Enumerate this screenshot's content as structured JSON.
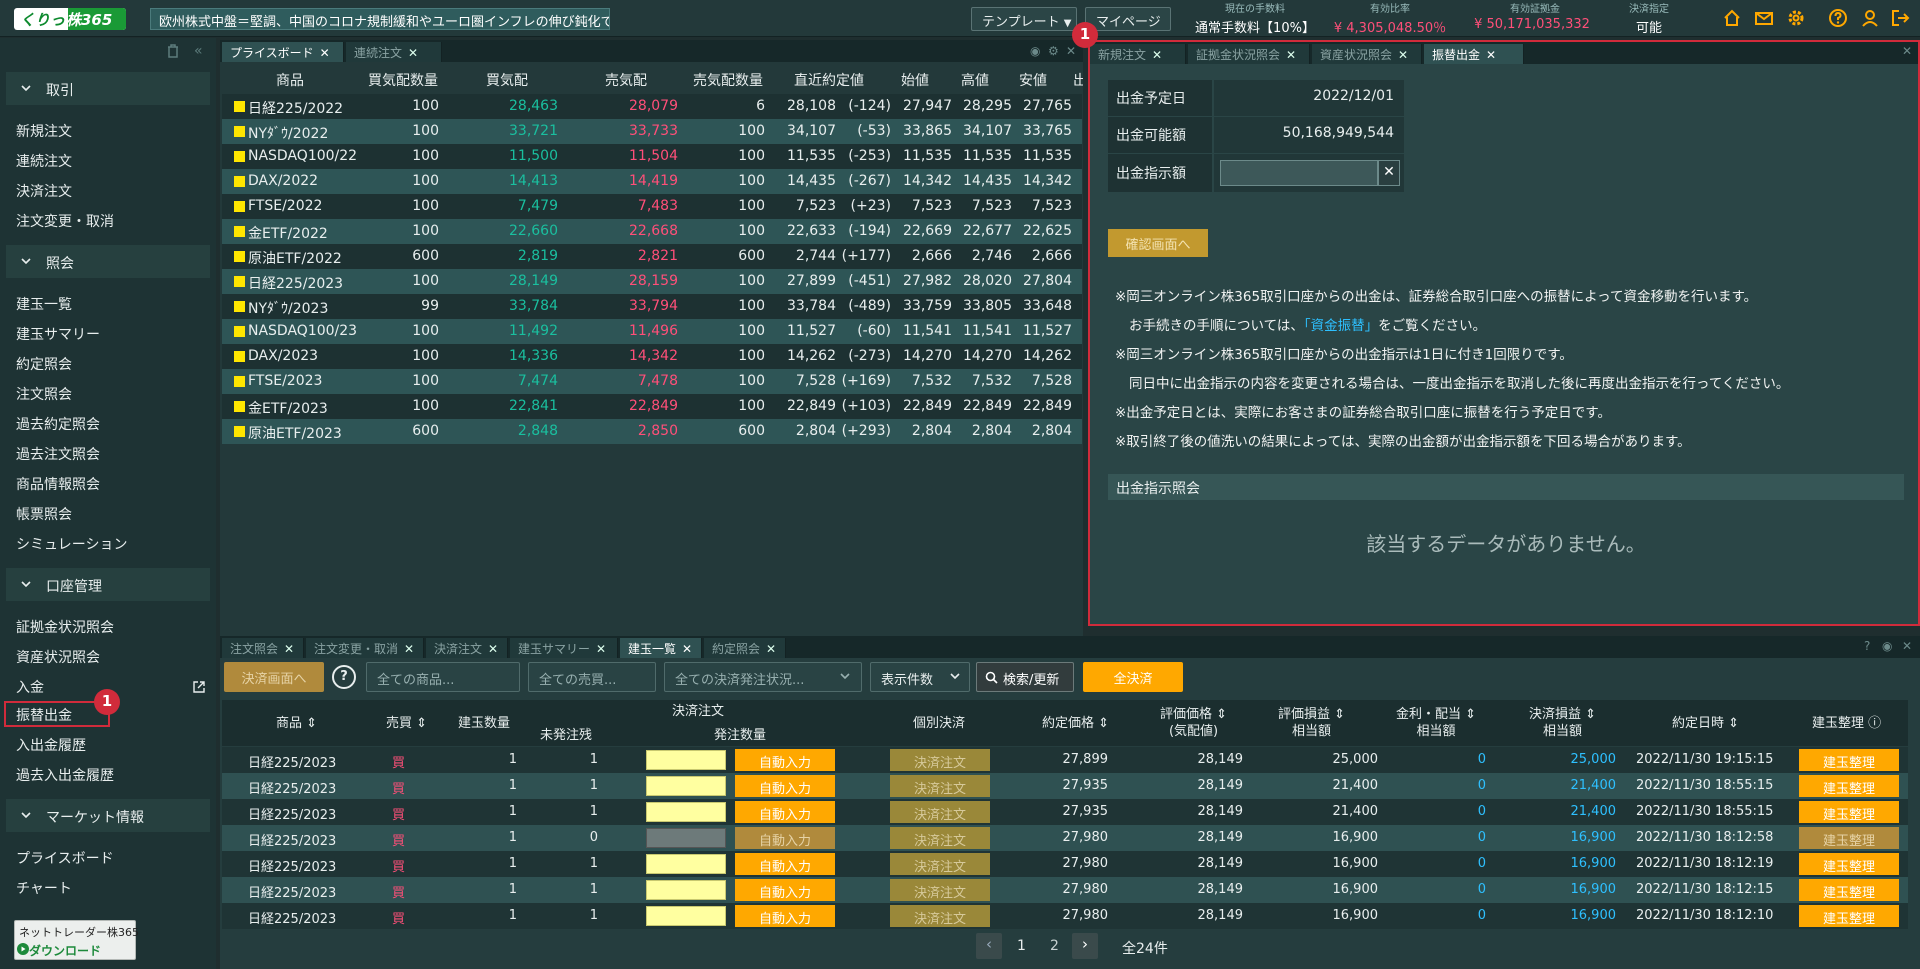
{
  "header": {
    "logo": {
      "part1": "くりっく",
      "part2": "株365"
    },
    "ticker": "欧州株式中盤＝堅調、中国のコロナ規制緩和やユーロ圏インフレの伸び鈍化で",
    "template_label": "テンプレート",
    "mypage_label": "マイページ",
    "fee": {
      "label": "現在の手数料",
      "value": "通常手数料【10%】"
    },
    "margin_ratio": {
      "label": "有効比率",
      "value": "¥ 4,305,048.50％"
    },
    "effective_margin": {
      "label": "有効証拠金",
      "value": "¥ 50,171,035,332"
    },
    "settlement": {
      "label": "決済指定",
      "value": "可能"
    }
  },
  "sidebar": {
    "sections": [
      {
        "label": "取引",
        "items": [
          "新規注文",
          "連続注文",
          "決済注文",
          "注文変更・取消"
        ]
      },
      {
        "label": "照会",
        "items": [
          "建玉一覧",
          "建玉サマリー",
          "約定照会",
          "注文照会",
          "過去約定照会",
          "過去注文照会",
          "商品情報照会",
          "帳票照会",
          "シミュレーション"
        ]
      },
      {
        "label": "口座管理",
        "items": [
          "証拠金状況照会",
          "資産状況照会",
          "入金",
          "振替出金",
          "入出金履歴",
          "過去入出金履歴"
        ]
      },
      {
        "label": "マーケット情報",
        "items": [
          "プライスボード",
          "チャート"
        ]
      }
    ],
    "download": {
      "line1": "ネットトレーダー株365",
      "line2": "ダウンロード"
    }
  },
  "priceboard": {
    "tabs": [
      "プライスボード",
      "連続注文"
    ],
    "columns": [
      "商品",
      "買気配数量",
      "買気配",
      "売気配",
      "売気配数量",
      "直近約定値",
      "始値",
      "高値",
      "安値",
      "出"
    ],
    "rows": [
      [
        "日経225/2022",
        "100",
        "28,463",
        "28,079",
        "6",
        "28,108",
        "(-124)",
        "27,947",
        "28,295",
        "27,765"
      ],
      [
        "NYﾀﾞｳ/2022",
        "100",
        "33,721",
        "33,733",
        "100",
        "34,107",
        "(-53)",
        "33,865",
        "34,107",
        "33,765"
      ],
      [
        "NASDAQ100/22",
        "100",
        "11,500",
        "11,504",
        "100",
        "11,535",
        "(-253)",
        "11,535",
        "11,535",
        "11,535"
      ],
      [
        "DAX/2022",
        "100",
        "14,413",
        "14,419",
        "100",
        "14,435",
        "(-267)",
        "14,342",
        "14,435",
        "14,342"
      ],
      [
        "FTSE/2022",
        "100",
        "7,479",
        "7,483",
        "100",
        "7,523",
        "(+23)",
        "7,523",
        "7,523",
        "7,523"
      ],
      [
        "金ETF/2022",
        "100",
        "22,660",
        "22,668",
        "100",
        "22,633",
        "(-194)",
        "22,669",
        "22,677",
        "22,625"
      ],
      [
        "原油ETF/2022",
        "600",
        "2,819",
        "2,821",
        "600",
        "2,744",
        "(+177)",
        "2,666",
        "2,746",
        "2,666"
      ],
      [
        "日経225/2023",
        "100",
        "28,149",
        "28,159",
        "100",
        "27,899",
        "(-451)",
        "27,982",
        "28,020",
        "27,804"
      ],
      [
        "NYﾀﾞｳ/2023",
        "99",
        "33,784",
        "33,794",
        "100",
        "33,784",
        "(-489)",
        "33,759",
        "33,805",
        "33,648"
      ],
      [
        "NASDAQ100/23",
        "100",
        "11,492",
        "11,496",
        "100",
        "11,527",
        "(-60)",
        "11,541",
        "11,541",
        "11,527"
      ],
      [
        "DAX/2023",
        "100",
        "14,336",
        "14,342",
        "100",
        "14,262",
        "(-273)",
        "14,270",
        "14,270",
        "14,262"
      ],
      [
        "FTSE/2023",
        "100",
        "7,474",
        "7,478",
        "100",
        "7,528",
        "(+169)",
        "7,532",
        "7,532",
        "7,528"
      ],
      [
        "金ETF/2023",
        "100",
        "22,841",
        "22,849",
        "100",
        "22,849",
        "(+103)",
        "22,849",
        "22,849",
        "22,849"
      ],
      [
        "原油ETF/2023",
        "600",
        "2,848",
        "2,850",
        "600",
        "2,804",
        "(+293)",
        "2,804",
        "2,804",
        "2,804"
      ]
    ]
  },
  "withdrawal": {
    "tabs": [
      "新規注文",
      "証拠金状況照会",
      "資産状況照会",
      "振替出金"
    ],
    "fields": [
      {
        "label": "出金予定日",
        "value": "2022/12/01"
      },
      {
        "label": "出金可能額",
        "value": "50,168,949,544"
      },
      {
        "label": "出金指示額",
        "value": ""
      }
    ],
    "confirm_label": "確認画面へ",
    "notes": {
      "n1": "※岡三オンライン株365取引口座からの出金は、証券総合取引口座への振替によって資金移動を行います。",
      "n2a": "お手続きの手順については、",
      "n2link": "「資金振替」",
      "n2b": "をご覧ください。",
      "n3": "※岡三オンライン株365取引口座からの出金指示は1日に付き1回限りです。",
      "n4": "同日中に出金指示の内容を変更される場合は、一度出金指示を取消した後に再度出金指示を行ってください。",
      "n5": "※出金予定日とは、実際にお客さまの証券総合取引口座に振替を行う予定日です。",
      "n6": "※取引終了後の値洗いの結果によっては、実際の出金額が出金指示額を下回る場合があります。"
    },
    "section_label": "出金指示照会",
    "no_data": "該当するデータがありません。"
  },
  "positions": {
    "tabs": [
      "注文照会",
      "注文変更・取消",
      "決済注文",
      "建玉サマリー",
      "建玉一覧",
      "約定照会"
    ],
    "toolbar": {
      "settle_screen": "決済画面へ",
      "help": "?",
      "product_ph": "全ての商品...",
      "side_ph": "全ての売買...",
      "status_ph": "全ての決済発注状況...",
      "count": "表示件数",
      "search": "検索/更新",
      "settle_all": "全決済"
    },
    "headers": {
      "product": "商品",
      "side": "売買",
      "qty": "建玉数量",
      "settle_order": "決済注文",
      "unfilled": "未発注残",
      "order_qty": "発注数量",
      "individual": "個別決済",
      "price": "約定価格",
      "eval_price_1": "評価価格",
      "eval_price_2": "(気配値)",
      "pl_1": "評価損益",
      "pl_2": "相当額",
      "div_1": "金利・配当",
      "div_2": "相当額",
      "spl_1": "決済損益",
      "spl_2": "相当額",
      "date": "約定日時",
      "manage": "建玉整理"
    },
    "rows": [
      {
        "product": "日経225/2023",
        "side": "買",
        "qty": "1",
        "unfilled": "1",
        "auto": "自動入力",
        "kessai": "決済注文",
        "price": "27,899",
        "eval": "28,149",
        "pl": "25,000",
        "div": "0",
        "spl": "25,000",
        "date": "2022/11/30 19:15:15",
        "manage": "建玉整理"
      },
      {
        "product": "日経225/2023",
        "side": "買",
        "qty": "1",
        "unfilled": "1",
        "auto": "自動入力",
        "kessai": "決済注文",
        "price": "27,935",
        "eval": "28,149",
        "pl": "21,400",
        "div": "0",
        "spl": "21,400",
        "date": "2022/11/30 18:55:15",
        "manage": "建玉整理"
      },
      {
        "product": "日経225/2023",
        "side": "買",
        "qty": "1",
        "unfilled": "1",
        "auto": "自動入力",
        "kessai": "決済注文",
        "price": "27,935",
        "eval": "28,149",
        "pl": "21,400",
        "div": "0",
        "spl": "21,400",
        "date": "2022/11/30 18:55:15",
        "manage": "建玉整理"
      },
      {
        "product": "日経225/2023",
        "side": "買",
        "qty": "1",
        "unfilled": "0",
        "auto": "自動入力",
        "kessai": "決済注文",
        "price": "27,980",
        "eval": "28,149",
        "pl": "16,900",
        "div": "0",
        "spl": "16,900",
        "date": "2022/11/30 18:12:58",
        "manage": "建玉整理"
      },
      {
        "product": "日経225/2023",
        "side": "買",
        "qty": "1",
        "unfilled": "1",
        "auto": "自動入力",
        "kessai": "決済注文",
        "price": "27,980",
        "eval": "28,149",
        "pl": "16,900",
        "div": "0",
        "spl": "16,900",
        "date": "2022/11/30 18:12:19",
        "manage": "建玉整理"
      },
      {
        "product": "日経225/2023",
        "side": "買",
        "qty": "1",
        "unfilled": "1",
        "auto": "自動入力",
        "kessai": "決済注文",
        "price": "27,980",
        "eval": "28,149",
        "pl": "16,900",
        "div": "0",
        "spl": "16,900",
        "date": "2022/11/30 18:12:15",
        "manage": "建玉整理"
      },
      {
        "product": "日経225/2023",
        "side": "買",
        "qty": "1",
        "unfilled": "1",
        "auto": "自動入力",
        "kessai": "決済注文",
        "price": "27,980",
        "eval": "28,149",
        "pl": "16,900",
        "div": "0",
        "spl": "16,900",
        "date": "2022/11/30 18:12:10",
        "manage": "建玉整理"
      }
    ],
    "pagination": {
      "page1": "1",
      "page2": "2",
      "total": "全24件"
    }
  },
  "annotations": {
    "marker": "1"
  }
}
